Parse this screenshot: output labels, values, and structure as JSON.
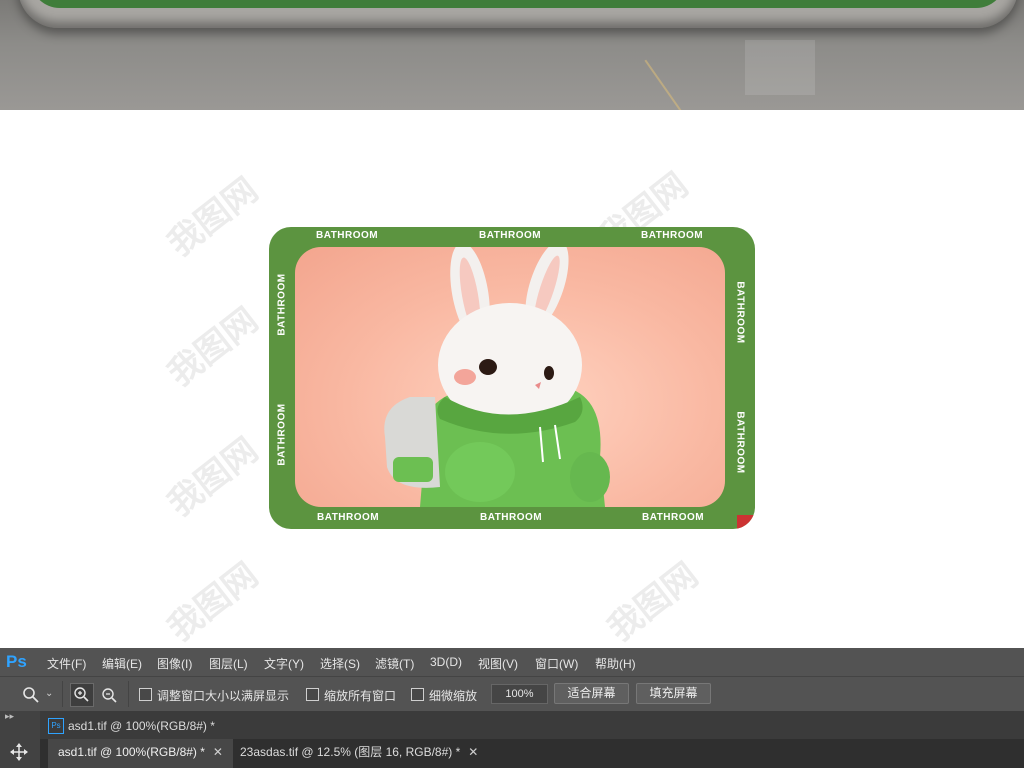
{
  "watermark_text": "我图网",
  "mat": {
    "labels_top": [
      "BATHROOM",
      "BATHROOM",
      "BATHROOM"
    ],
    "labels_bottom": [
      "BATHROOM",
      "BATHROOM",
      "BATHROOM"
    ],
    "labels_left": [
      "BATHROOM",
      "BATHROOM"
    ],
    "labels_right": [
      "BATHROOM",
      "BATHROOM"
    ],
    "colors": {
      "border": "#5c9440",
      "inner": "#f9b8a2",
      "jacket": "#6cbf52"
    }
  },
  "ps": {
    "logo": "Ps",
    "menu": [
      "文件(F)",
      "编辑(E)",
      "图像(I)",
      "图层(L)",
      "文字(Y)",
      "选择(S)",
      "滤镜(T)",
      "3D(D)",
      "视图(V)",
      "窗口(W)",
      "帮助(H)"
    ],
    "options": {
      "resize_windows_label": "调整窗口大小以满屏显示",
      "zoom_all_label": "缩放所有窗口",
      "scrubby_zoom_label": "细微缩放",
      "zoom_value": "100%",
      "fit_screen_label": "适合屏幕",
      "fill_screen_label": "填充屏幕"
    },
    "doc_title": "asd1.tif @ 100%(RGB/8#) *",
    "tabs": [
      {
        "label": "asd1.tif @ 100%(RGB/8#) *"
      },
      {
        "label": "23asdas.tif @ 12.5% (图层 16, RGB/8#) *"
      }
    ]
  }
}
